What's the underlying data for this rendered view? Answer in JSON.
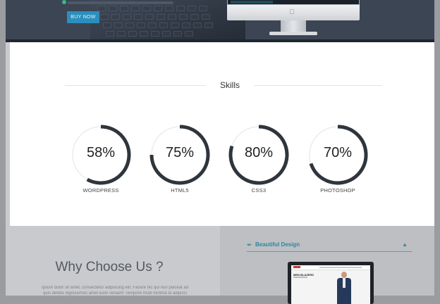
{
  "hero": {
    "buy_label": "BUY NOW"
  },
  "skills": {
    "title": "Skills",
    "items": [
      {
        "label": "WORDPRESS",
        "percent_text": "58%",
        "value": 58
      },
      {
        "label": "HTML5",
        "percent_text": "75%",
        "value": 75
      },
      {
        "label": "CSS3",
        "percent_text": "80%",
        "value": 80
      },
      {
        "label": "PHOTOSHOP",
        "percent_text": "70%",
        "value": 70
      }
    ],
    "ring_color": "#2f353d",
    "track_color": "#ececec"
  },
  "why": {
    "title": "Why Choose Us ?",
    "line1": "Ipsum dolor sit amet, consectetur adipiscing elit. Facere hic qui non placeat ad",
    "line2": "quis debitis dignissimos amet iusto veniam! Tempore modi minima at adipisci"
  },
  "accordion": {
    "title": "Beautiful Design",
    "icon": "brush-icon",
    "chevron": "chevron-up-icon",
    "accent": "#2b87a3"
  },
  "mock_site": {
    "promo_text": "MEN BLAZERS"
  }
}
